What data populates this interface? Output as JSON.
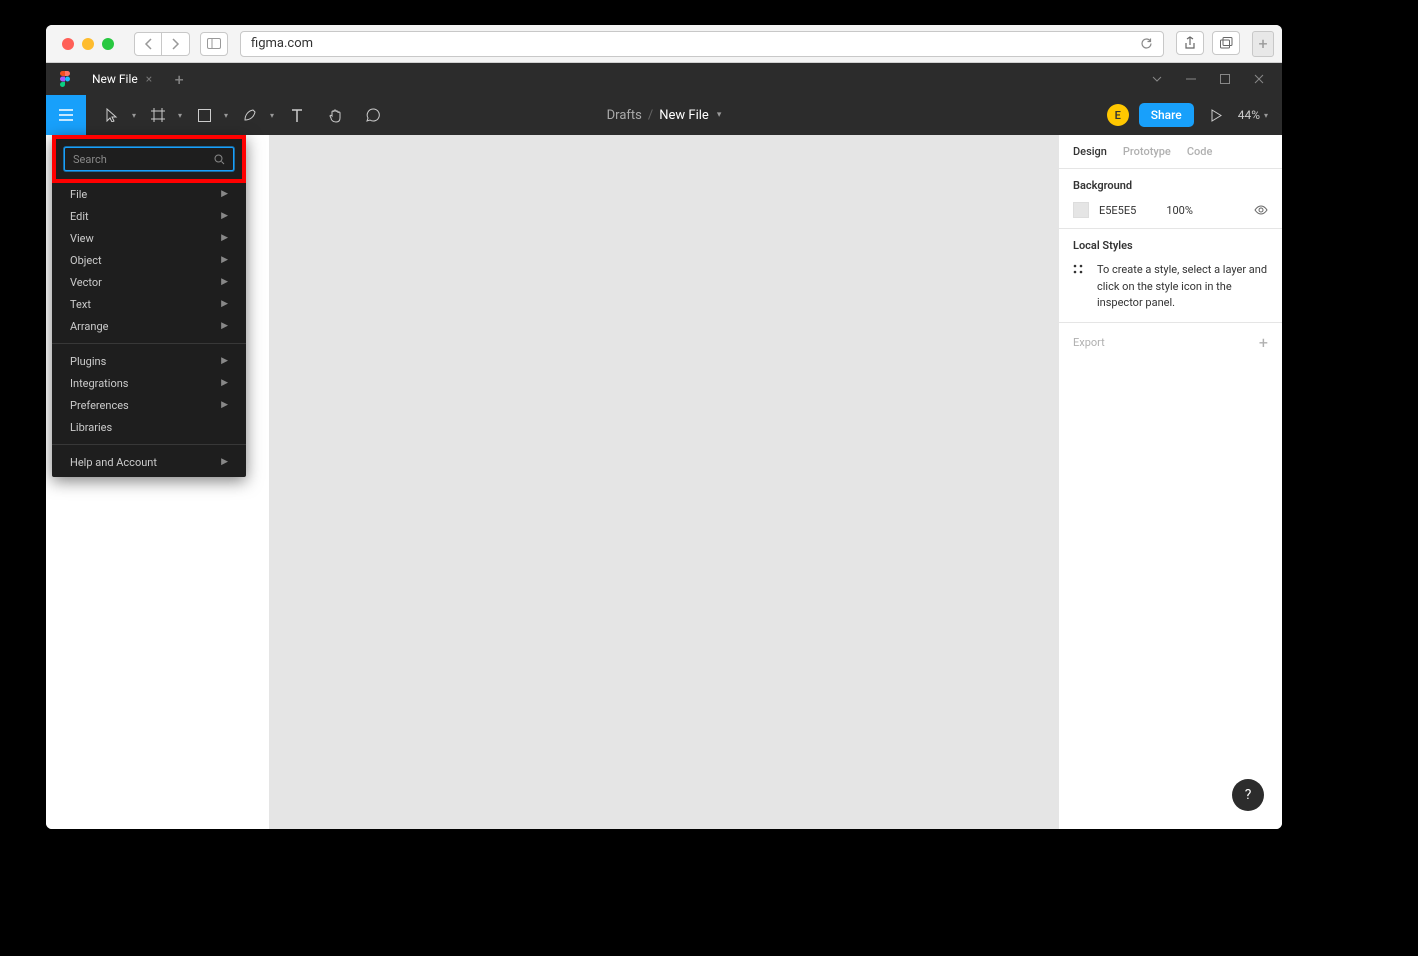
{
  "browser": {
    "url": "figma.com"
  },
  "titlebar": {
    "tab_name": "New File"
  },
  "toolbar": {
    "breadcrumb_parent": "Drafts",
    "breadcrumb_name": "New File",
    "avatar_letter": "E",
    "share_label": "Share",
    "zoom": "44%"
  },
  "menu": {
    "search_placeholder": "Search",
    "groups": [
      {
        "items": [
          "File",
          "Edit",
          "View",
          "Object",
          "Vector",
          "Text",
          "Arrange"
        ]
      },
      {
        "items": [
          "Plugins",
          "Integrations",
          "Preferences",
          "Libraries"
        ]
      },
      {
        "items": [
          "Help and Account"
        ]
      }
    ]
  },
  "right_panel": {
    "tabs": {
      "design": "Design",
      "prototype": "Prototype",
      "code": "Code"
    },
    "background": {
      "title": "Background",
      "hex": "E5E5E5",
      "opacity": "100%"
    },
    "local_styles": {
      "title": "Local Styles",
      "hint": "To create a style, select a layer and click on the style icon in the inspector panel."
    },
    "export_label": "Export"
  }
}
